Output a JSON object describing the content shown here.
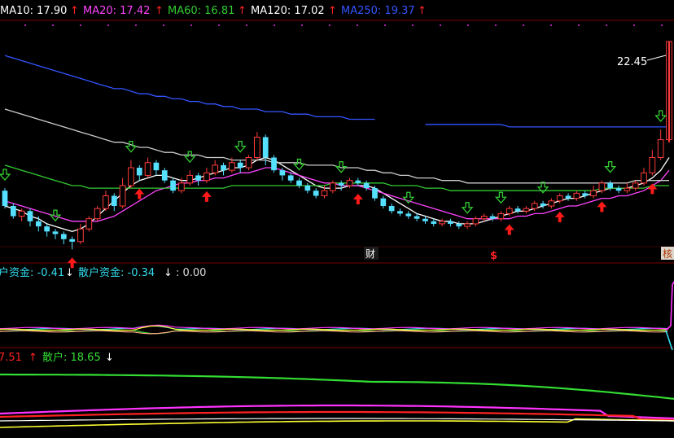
{
  "colors": {
    "bg": "#000000",
    "grid": "#7a0000",
    "up": "#ff3b3b",
    "down": "#55e0ff",
    "ma10": "#ffffff",
    "ma20": "#ff44ff",
    "ma60": "#33cc33",
    "ma120": "#cccccc",
    "ma250": "#3355ff",
    "arrowUp": "#ff1a1a",
    "arrowDown": "#33cc33",
    "text": "#dddddd",
    "yellow": "#ffff33",
    "red": "#ff2222",
    "green": "#33dd33",
    "magenta": "#ff33ff",
    "cyan": "#33ddee"
  },
  "header": {
    "ma10": "MA10: 17.90",
    "ma20": "MA20: 17.42",
    "ma60": "MA60: 16.81",
    "ma120": "MA120: 17.02",
    "ma250": "MA250: 19.37",
    "arrow": "↑"
  },
  "price_panel": {
    "max_label": "22.45",
    "markers": [
      "财",
      "$",
      "核"
    ]
  },
  "capital_panel": {
    "label1": "户资金: -0.41",
    "arrow1": "↓",
    "label2": "散户资金: -0.34",
    "arrow2": "↓",
    "label3": ": 0.00"
  },
  "retail_panel": {
    "label1": "7.51",
    "arrow1": "↑",
    "label2": "散户: 18.65",
    "arrow2": "↓"
  },
  "chart_data": {
    "type": "line",
    "title": "",
    "price_ylim": [
      14.5,
      22.8
    ],
    "max_price": 22.45,
    "candles": [
      [
        16.6,
        16.0,
        16.7,
        15.9
      ],
      [
        16.0,
        15.6,
        16.1,
        15.5
      ],
      [
        15.6,
        15.8,
        15.9,
        15.4
      ],
      [
        15.8,
        15.4,
        15.9,
        15.2
      ],
      [
        15.4,
        15.2,
        15.6,
        15.0
      ],
      [
        15.2,
        15.0,
        15.3,
        14.8
      ],
      [
        15.0,
        14.9,
        15.1,
        14.7
      ],
      [
        14.9,
        14.7,
        15.0,
        14.5
      ],
      [
        14.7,
        14.6,
        14.8,
        14.3
      ],
      [
        14.6,
        15.1,
        15.3,
        14.5
      ],
      [
        15.1,
        15.5,
        15.6,
        15.0
      ],
      [
        15.5,
        15.9,
        16.0,
        15.4
      ],
      [
        15.9,
        16.4,
        16.6,
        15.8
      ],
      [
        16.4,
        16.0,
        16.5,
        15.8
      ],
      [
        16.0,
        16.8,
        17.1,
        15.9
      ],
      [
        16.8,
        17.5,
        17.8,
        16.7
      ],
      [
        17.5,
        17.2,
        17.6,
        17.0
      ],
      [
        17.2,
        17.7,
        17.9,
        17.1
      ],
      [
        17.7,
        17.4,
        17.8,
        17.2
      ],
      [
        17.4,
        17.0,
        17.5,
        16.9
      ],
      [
        17.0,
        16.6,
        17.1,
        16.5
      ],
      [
        16.6,
        16.9,
        17.1,
        16.5
      ],
      [
        16.9,
        17.2,
        17.4,
        16.8
      ],
      [
        17.2,
        17.0,
        17.3,
        16.8
      ],
      [
        17.0,
        17.3,
        17.5,
        16.9
      ],
      [
        17.3,
        17.6,
        17.8,
        17.2
      ],
      [
        17.6,
        17.4,
        17.7,
        17.2
      ],
      [
        17.4,
        17.7,
        17.9,
        17.3
      ],
      [
        17.7,
        17.5,
        17.8,
        17.3
      ],
      [
        17.5,
        17.9,
        18.0,
        17.4
      ],
      [
        17.9,
        18.7,
        18.9,
        17.8
      ],
      [
        18.7,
        17.9,
        18.8,
        17.6
      ],
      [
        17.9,
        17.4,
        18.0,
        17.3
      ],
      [
        17.4,
        17.2,
        17.5,
        17.0
      ],
      [
        17.2,
        17.0,
        17.3,
        16.9
      ],
      [
        17.0,
        16.8,
        17.1,
        16.7
      ],
      [
        16.8,
        16.6,
        16.9,
        16.5
      ],
      [
        16.6,
        16.4,
        16.7,
        16.3
      ],
      [
        16.4,
        16.6,
        16.8,
        16.3
      ],
      [
        16.6,
        16.9,
        17.0,
        16.5
      ],
      [
        16.9,
        16.8,
        17.0,
        16.6
      ],
      [
        16.8,
        17.0,
        17.1,
        16.7
      ],
      [
        17.0,
        16.9,
        17.1,
        16.8
      ],
      [
        16.9,
        16.7,
        17.0,
        16.6
      ],
      [
        16.7,
        16.3,
        16.8,
        16.2
      ],
      [
        16.3,
        16.0,
        16.4,
        15.9
      ],
      [
        16.0,
        15.8,
        16.1,
        15.7
      ],
      [
        15.8,
        15.7,
        15.9,
        15.6
      ],
      [
        15.7,
        15.6,
        15.8,
        15.5
      ],
      [
        15.6,
        15.5,
        15.7,
        15.4
      ],
      [
        15.5,
        15.4,
        15.6,
        15.3
      ],
      [
        15.4,
        15.3,
        15.5,
        15.2
      ],
      [
        15.3,
        15.4,
        15.5,
        15.2
      ],
      [
        15.4,
        15.3,
        15.5,
        15.2
      ],
      [
        15.3,
        15.2,
        15.4,
        15.1
      ],
      [
        15.2,
        15.3,
        15.4,
        15.1
      ],
      [
        15.3,
        15.5,
        15.6,
        15.2
      ],
      [
        15.5,
        15.6,
        15.7,
        15.4
      ],
      [
        15.6,
        15.5,
        15.7,
        15.4
      ],
      [
        15.5,
        15.7,
        15.8,
        15.4
      ],
      [
        15.7,
        15.9,
        16.0,
        15.6
      ],
      [
        15.9,
        15.8,
        16.0,
        15.7
      ],
      [
        15.8,
        15.9,
        16.0,
        15.7
      ],
      [
        15.9,
        16.1,
        16.2,
        15.8
      ],
      [
        16.1,
        16.0,
        16.2,
        15.9
      ],
      [
        16.0,
        16.2,
        16.3,
        15.9
      ],
      [
        16.2,
        16.4,
        16.5,
        16.1
      ],
      [
        16.4,
        16.3,
        16.5,
        16.2
      ],
      [
        16.3,
        16.5,
        16.6,
        16.2
      ],
      [
        16.5,
        16.4,
        16.6,
        16.3
      ],
      [
        16.4,
        16.6,
        16.8,
        16.3
      ],
      [
        16.6,
        16.9,
        17.0,
        16.5
      ],
      [
        16.9,
        16.7,
        17.0,
        16.6
      ],
      [
        16.7,
        16.6,
        16.8,
        16.5
      ],
      [
        16.6,
        16.7,
        16.9,
        16.5
      ],
      [
        16.7,
        16.9,
        17.0,
        16.6
      ],
      [
        16.9,
        17.3,
        17.5,
        16.8
      ],
      [
        17.3,
        17.9,
        18.2,
        17.2
      ],
      [
        17.9,
        18.6,
        19.0,
        17.8
      ],
      [
        18.6,
        22.45,
        22.45,
        18.5
      ]
    ],
    "series": [
      {
        "name": "MA10",
        "values": [
          16.0,
          15.9,
          15.8,
          15.6,
          15.5,
          15.3,
          15.2,
          15.1,
          15.0,
          15.1,
          15.3,
          15.6,
          15.9,
          16.2,
          16.5,
          16.8,
          17.0,
          17.1,
          17.2,
          17.2,
          17.1,
          17.0,
          17.0,
          17.1,
          17.2,
          17.3,
          17.4,
          17.5,
          17.5,
          17.6,
          17.8,
          17.9,
          17.8,
          17.6,
          17.4,
          17.2,
          17.0,
          16.8,
          16.7,
          16.7,
          16.7,
          16.8,
          16.8,
          16.8,
          16.7,
          16.5,
          16.3,
          16.1,
          15.9,
          15.7,
          15.6,
          15.5,
          15.4,
          15.4,
          15.3,
          15.3,
          15.3,
          15.4,
          15.5,
          15.6,
          15.7,
          15.8,
          15.8,
          15.9,
          16.0,
          16.1,
          16.2,
          16.3,
          16.3,
          16.4,
          16.5,
          16.6,
          16.7,
          16.7,
          16.7,
          16.8,
          16.9,
          17.1,
          17.4,
          17.9
        ]
      },
      {
        "name": "MA20",
        "values": [
          16.2,
          16.1,
          16.0,
          15.9,
          15.8,
          15.7,
          15.6,
          15.5,
          15.4,
          15.4,
          15.4,
          15.4,
          15.5,
          15.6,
          15.8,
          16.0,
          16.2,
          16.4,
          16.6,
          16.7,
          16.8,
          16.9,
          16.9,
          17.0,
          17.0,
          17.1,
          17.1,
          17.2,
          17.3,
          17.3,
          17.4,
          17.5,
          17.5,
          17.4,
          17.3,
          17.2,
          17.1,
          17.0,
          16.9,
          16.9,
          16.8,
          16.8,
          16.8,
          16.7,
          16.6,
          16.5,
          16.4,
          16.3,
          16.2,
          16.1,
          16.0,
          15.9,
          15.8,
          15.7,
          15.6,
          15.5,
          15.5,
          15.5,
          15.5,
          15.5,
          15.5,
          15.6,
          15.6,
          15.7,
          15.7,
          15.8,
          15.9,
          16.0,
          16.0,
          16.1,
          16.2,
          16.3,
          16.3,
          16.4,
          16.4,
          16.5,
          16.6,
          16.8,
          17.0,
          17.4
        ]
      },
      {
        "name": "MA60",
        "values": [
          17.6,
          17.5,
          17.4,
          17.3,
          17.2,
          17.1,
          17.0,
          16.9,
          16.8,
          16.8,
          16.7,
          16.7,
          16.7,
          16.7,
          16.7,
          16.7,
          16.7,
          16.7,
          16.7,
          16.7,
          16.7,
          16.7,
          16.7,
          16.7,
          16.7,
          16.7,
          16.7,
          16.8,
          16.8,
          16.8,
          16.8,
          16.8,
          16.8,
          16.8,
          16.8,
          16.8,
          16.8,
          16.8,
          16.8,
          16.9,
          16.9,
          16.9,
          16.9,
          16.9,
          16.9,
          16.9,
          16.8,
          16.8,
          16.8,
          16.8,
          16.7,
          16.7,
          16.7,
          16.6,
          16.6,
          16.6,
          16.6,
          16.6,
          16.6,
          16.6,
          16.6,
          16.6,
          16.6,
          16.6,
          16.6,
          16.6,
          16.6,
          16.6,
          16.6,
          16.6,
          16.6,
          16.7,
          16.7,
          16.7,
          16.7,
          16.7,
          16.7,
          16.8,
          16.8,
          16.8
        ]
      },
      {
        "name": "MA120",
        "values": [
          19.8,
          19.7,
          19.6,
          19.5,
          19.4,
          19.3,
          19.2,
          19.1,
          19.0,
          18.9,
          18.8,
          18.7,
          18.6,
          18.5,
          18.5,
          18.4,
          18.3,
          18.3,
          18.2,
          18.1,
          18.1,
          18.0,
          18.0,
          18.0,
          17.9,
          17.9,
          17.9,
          17.8,
          17.8,
          17.8,
          17.8,
          17.8,
          17.7,
          17.7,
          17.7,
          17.7,
          17.6,
          17.6,
          17.6,
          17.6,
          17.5,
          17.5,
          17.5,
          17.4,
          17.4,
          17.3,
          17.3,
          17.2,
          17.2,
          17.1,
          17.1,
          17.1,
          17.0,
          17.0,
          17.0,
          16.9,
          16.9,
          16.9,
          16.9,
          16.9,
          16.9,
          16.9,
          16.9,
          16.9,
          16.9,
          16.9,
          16.9,
          16.9,
          16.9,
          16.9,
          16.9,
          16.9,
          16.9,
          16.9,
          16.9,
          17.0,
          17.0,
          17.0,
          17.0,
          17.0
        ]
      },
      {
        "name": "MA250",
        "values": [
          21.9,
          21.8,
          21.7,
          21.6,
          21.5,
          21.4,
          21.3,
          21.2,
          21.1,
          21.0,
          20.9,
          20.8,
          20.7,
          20.6,
          20.6,
          20.5,
          20.4,
          20.4,
          20.3,
          20.3,
          20.2,
          20.2,
          20.1,
          20.1,
          20.0,
          20.0,
          19.9,
          19.9,
          19.8,
          19.8,
          19.8,
          19.7,
          19.7,
          19.7,
          19.6,
          19.6,
          19.6,
          19.5,
          19.5,
          19.5,
          19.5,
          19.4,
          19.4,
          19.4,
          19.4,
          null,
          null,
          null,
          null,
          null,
          19.2,
          19.2,
          19.2,
          19.2,
          19.2,
          19.2,
          19.2,
          19.2,
          19.2,
          19.2,
          19.1,
          19.1,
          19.1,
          19.1,
          19.1,
          19.1,
          19.1,
          19.1,
          19.1,
          19.1,
          19.1,
          19.1,
          19.1,
          19.1,
          19.1,
          19.1,
          19.1,
          19.1,
          19.1,
          19.1
        ]
      }
    ],
    "buy_signals": [
      8,
      16,
      24,
      42,
      60,
      66,
      71,
      77,
      83,
      88,
      93,
      99
    ],
    "sell_signals": [
      0,
      6,
      15,
      22,
      28,
      35,
      40,
      48,
      55,
      59,
      64,
      72,
      78,
      84,
      89,
      95
    ]
  }
}
